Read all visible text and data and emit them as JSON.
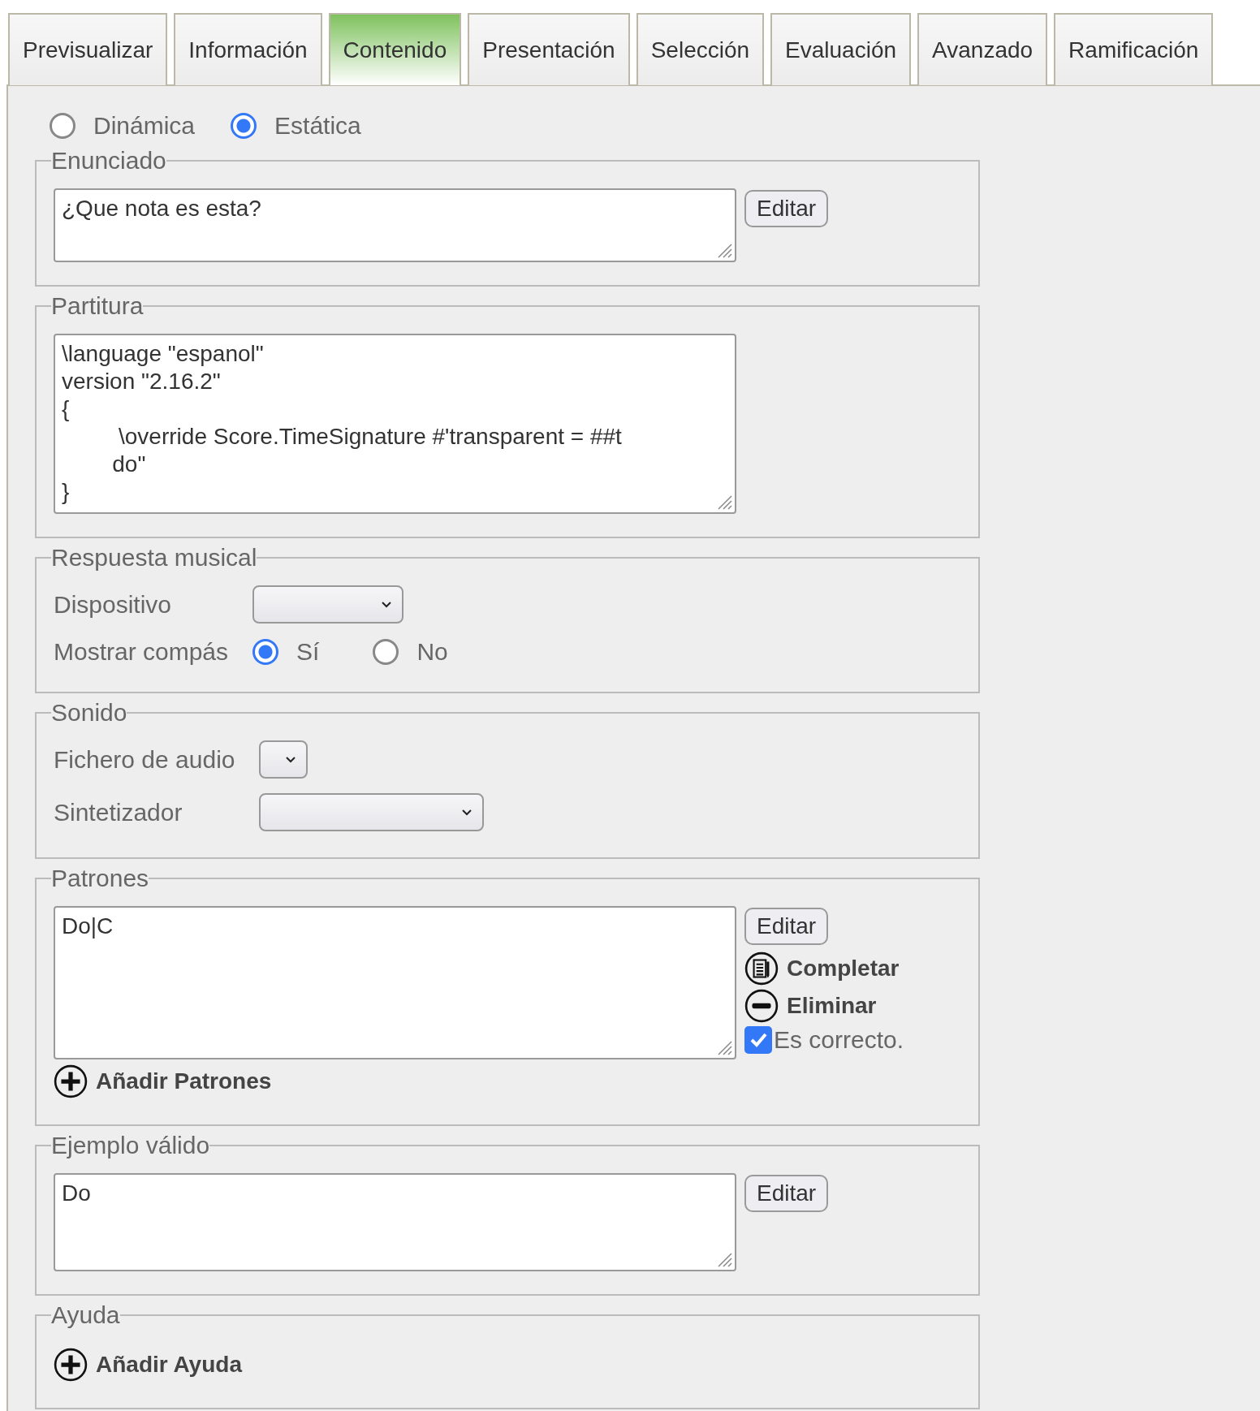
{
  "tabs": [
    {
      "label": "Previsualizar",
      "selected": false
    },
    {
      "label": "Información",
      "selected": false
    },
    {
      "label": "Contenido",
      "selected": true
    },
    {
      "label": "Presentación",
      "selected": false
    },
    {
      "label": "Selección",
      "selected": false
    },
    {
      "label": "Evaluación",
      "selected": false
    },
    {
      "label": "Avanzado",
      "selected": false
    },
    {
      "label": "Ramificación",
      "selected": false
    }
  ],
  "mode": [
    {
      "label": "Dinámica",
      "selected": false
    },
    {
      "label": "Estática",
      "selected": true
    }
  ],
  "sections": [
    {
      "kind": "editor",
      "legend": "Enunciado",
      "text": "¿Que nota es esta?",
      "side": [
        {
          "kind": "button",
          "label": "Editar"
        }
      ]
    },
    {
      "kind": "editor",
      "legend": "Partitura",
      "text": "\\language \"espanol\"\nversion \"2.16.2\"\n{\n\t \\override Score.TimeSignature #'transparent = ##t\n\tdo\"\n}"
    },
    {
      "kind": "form",
      "legend": "Respuesta musical",
      "rows": [
        {
          "kind": "select",
          "label": "Dispositivo"
        },
        {
          "kind": "radio",
          "label": "Mostrar compás",
          "options": [
            {
              "label": "Sí",
              "selected": true
            },
            {
              "label": "No",
              "selected": false
            }
          ]
        }
      ]
    },
    {
      "kind": "form",
      "legend": "Sonido",
      "rows": [
        {
          "kind": "select",
          "label": "Fichero de audio"
        },
        {
          "kind": "select",
          "label": "Sintetizador"
        }
      ]
    },
    {
      "kind": "editor",
      "legend": "Patrones",
      "text": "Do|C",
      "side": [
        {
          "kind": "button",
          "label": "Editar"
        },
        {
          "kind": "complete",
          "label": "Completar"
        },
        {
          "kind": "remove",
          "label": "Eliminar"
        },
        {
          "kind": "checkbox",
          "label": "Es correcto.",
          "checked": true
        }
      ],
      "add": "Añadir Patrones"
    },
    {
      "kind": "editor",
      "legend": "Ejemplo válido",
      "text": "Do",
      "side": [
        {
          "kind": "button",
          "label": "Editar"
        }
      ]
    },
    {
      "kind": "add",
      "legend": "Ayuda",
      "add": "Añadir Ayuda"
    }
  ]
}
